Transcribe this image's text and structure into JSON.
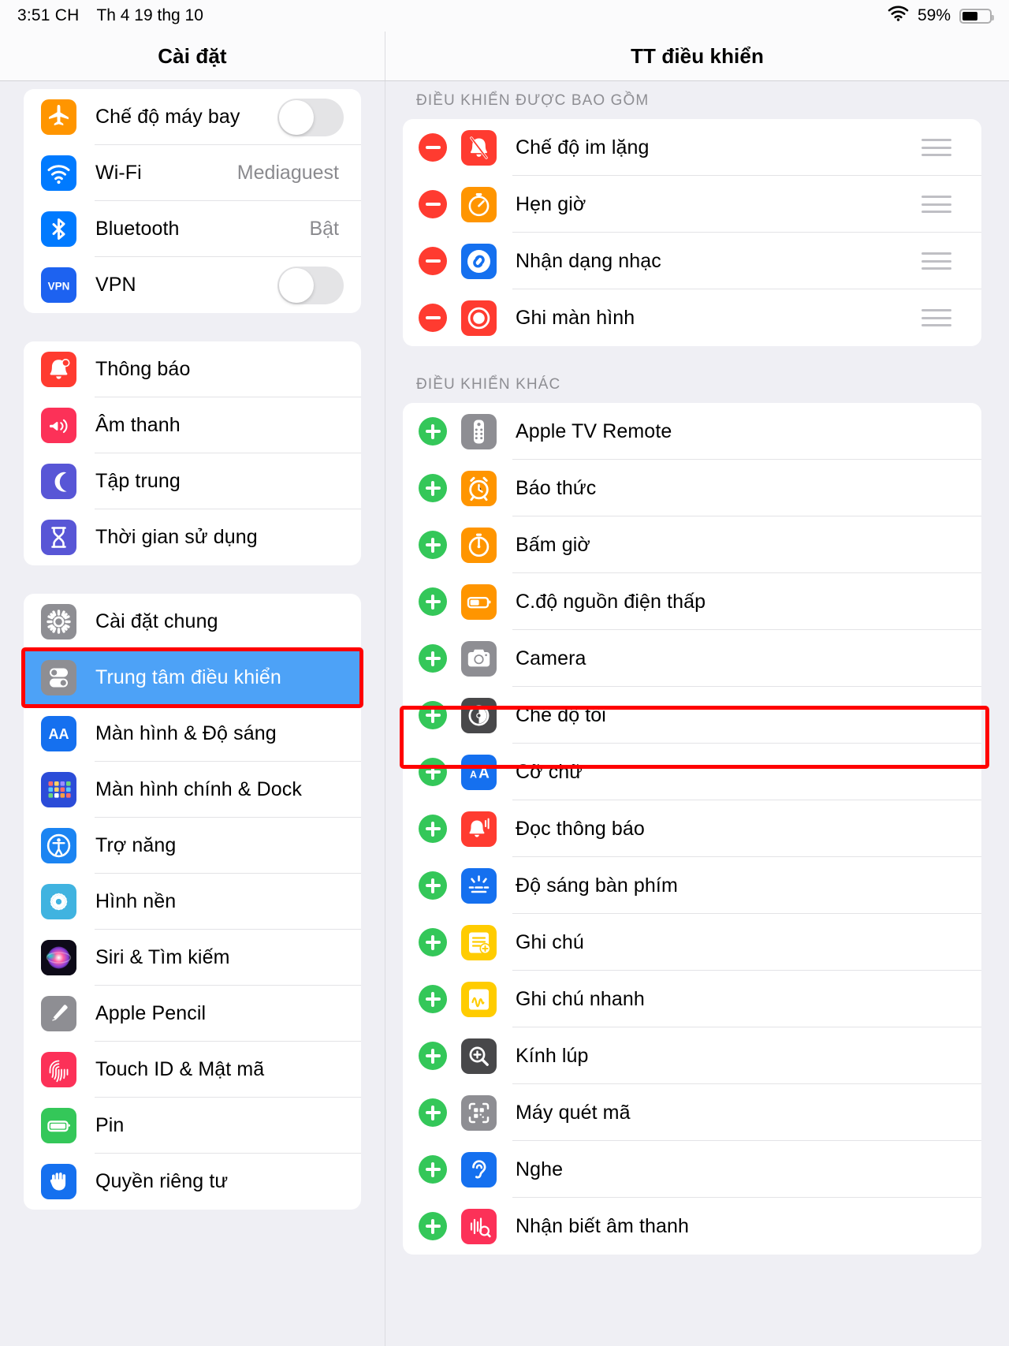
{
  "status_bar": {
    "time": "3:51 CH",
    "date": "Th 4 19 thg 10",
    "wifi_icon": "wifi-icon",
    "battery_percent": "59%",
    "battery_level": 59
  },
  "nav": {
    "sidebar_title": "Cài đặt",
    "detail_title": "TT điều khiển"
  },
  "colors": {
    "accent_selected": "#4da2f7",
    "annotation": "#ff0000",
    "add_badge": "#34c759",
    "remove_badge": "#ff3b30"
  },
  "sidebar": {
    "groups": [
      {
        "items": [
          {
            "label": "Chế độ máy bay",
            "icon": "airplane-icon",
            "icon_bg": "#ff9500",
            "accessory": "toggle",
            "toggle_on": false
          },
          {
            "label": "Wi-Fi",
            "icon": "wifi-icon",
            "icon_bg": "#007aff",
            "accessory": "value",
            "value": "Mediaguest"
          },
          {
            "label": "Bluetooth",
            "icon": "bluetooth-icon",
            "icon_bg": "#007aff",
            "accessory": "value",
            "value": "Bật"
          },
          {
            "label": "VPN",
            "icon": "vpn-icon",
            "icon_bg": "#1d62f0",
            "accessory": "toggle",
            "toggle_on": false
          }
        ]
      },
      {
        "items": [
          {
            "label": "Thông báo",
            "icon": "bell-icon",
            "icon_bg": "#ff3b30",
            "accessory": "none"
          },
          {
            "label": "Âm thanh",
            "icon": "speaker-icon",
            "icon_bg": "#fc3158",
            "accessory": "none"
          },
          {
            "label": "Tập trung",
            "icon": "moon-icon",
            "icon_bg": "#5856d6",
            "accessory": "none"
          },
          {
            "label": "Thời gian sử dụng",
            "icon": "hourglass-icon",
            "icon_bg": "#5856d6",
            "accessory": "none"
          }
        ]
      },
      {
        "items": [
          {
            "label": "Cài đặt chung",
            "icon": "gear-icon",
            "icon_bg": "#8e8e93",
            "accessory": "none"
          },
          {
            "label": "Trung tâm điều khiển",
            "icon": "control-center-icon",
            "icon_bg": "#8e8e93",
            "accessory": "none",
            "selected": true,
            "annotated": true
          },
          {
            "label": "Màn hình & Độ sáng",
            "icon": "aa-icon",
            "icon_bg": "#1570ef",
            "accessory": "none"
          },
          {
            "label": "Màn hình chính & Dock",
            "icon": "home-screen-icon",
            "icon_bg": "#2b4cd8",
            "accessory": "none"
          },
          {
            "label": "Trợ năng",
            "icon": "accessibility-icon",
            "icon_bg": "#1b84f2",
            "accessory": "none"
          },
          {
            "label": "Hình nền",
            "icon": "wallpaper-icon",
            "icon_bg": "#40b3e0",
            "accessory": "none"
          },
          {
            "label": "Siri & Tìm kiếm",
            "icon": "siri-icon",
            "icon_bg": "#1c1c1e",
            "accessory": "none"
          },
          {
            "label": "Apple Pencil",
            "icon": "pencil-icon",
            "icon_bg": "#8e8e93",
            "accessory": "none"
          },
          {
            "label": "Touch ID & Mật mã",
            "icon": "fingerprint-icon",
            "icon_bg": "#fc3158",
            "accessory": "none"
          },
          {
            "label": "Pin",
            "icon": "battery-icon",
            "icon_bg": "#34c759",
            "accessory": "none"
          },
          {
            "label": "Quyền riêng tư",
            "icon": "hand-icon",
            "icon_bg": "#1570ef",
            "accessory": "none"
          }
        ]
      }
    ]
  },
  "detail": {
    "sections": [
      {
        "header": "ĐIỀU KHIỂN ĐƯỢC BAO GỒM",
        "badge_type": "minus",
        "has_drag_handle": true,
        "items": [
          {
            "label": "Chế độ im lặng",
            "icon": "bell-slash-icon",
            "icon_bg": "#ff3b30"
          },
          {
            "label": "Hẹn giờ",
            "icon": "timer-icon",
            "icon_bg": "#ff9500"
          },
          {
            "label": "Nhận dạng nhạc",
            "icon": "shazam-icon",
            "icon_bg": "#1570ef"
          },
          {
            "label": "Ghi màn hình",
            "icon": "screen-record-icon",
            "icon_bg": "#ff3b30"
          }
        ]
      },
      {
        "header": "ĐIỀU KHIỂN KHÁC",
        "badge_type": "plus",
        "has_drag_handle": false,
        "items": [
          {
            "label": "Apple TV Remote",
            "icon": "tv-remote-icon",
            "icon_bg": "#8e8e93"
          },
          {
            "label": "Báo thức",
            "icon": "alarm-clock-icon",
            "icon_bg": "#ff9500"
          },
          {
            "label": "Bấm giờ",
            "icon": "stopwatch-icon",
            "icon_bg": "#ff9500"
          },
          {
            "label": "C.độ nguồn điện thấp",
            "icon": "low-power-icon",
            "icon_bg": "#ff9500"
          },
          {
            "label": "Camera",
            "icon": "camera-icon",
            "icon_bg": "#8e8e93"
          },
          {
            "label": "Chế độ tối",
            "icon": "dark-mode-icon",
            "icon_bg": "#48484a"
          },
          {
            "label": "Cỡ chữ",
            "icon": "text-size-icon",
            "icon_bg": "#1570ef",
            "annotated": true
          },
          {
            "label": "Đọc thông báo",
            "icon": "announce-notifications-icon",
            "icon_bg": "#ff3b30"
          },
          {
            "label": "Độ sáng bàn phím",
            "icon": "keyboard-brightness-icon",
            "icon_bg": "#1570ef"
          },
          {
            "label": "Ghi chú",
            "icon": "notes-icon",
            "icon_bg": "#ffcc00"
          },
          {
            "label": "Ghi chú nhanh",
            "icon": "quick-note-icon",
            "icon_bg": "#ffcc00"
          },
          {
            "label": "Kính lúp",
            "icon": "magnifier-icon",
            "icon_bg": "#48484a"
          },
          {
            "label": "Máy quét mã",
            "icon": "code-scanner-icon",
            "icon_bg": "#8e8e93"
          },
          {
            "label": "Nghe",
            "icon": "hearing-icon",
            "icon_bg": "#1570ef"
          },
          {
            "label": "Nhận biết âm thanh",
            "icon": "sound-recognition-icon",
            "icon_bg": "#fc3158"
          }
        ]
      }
    ]
  }
}
